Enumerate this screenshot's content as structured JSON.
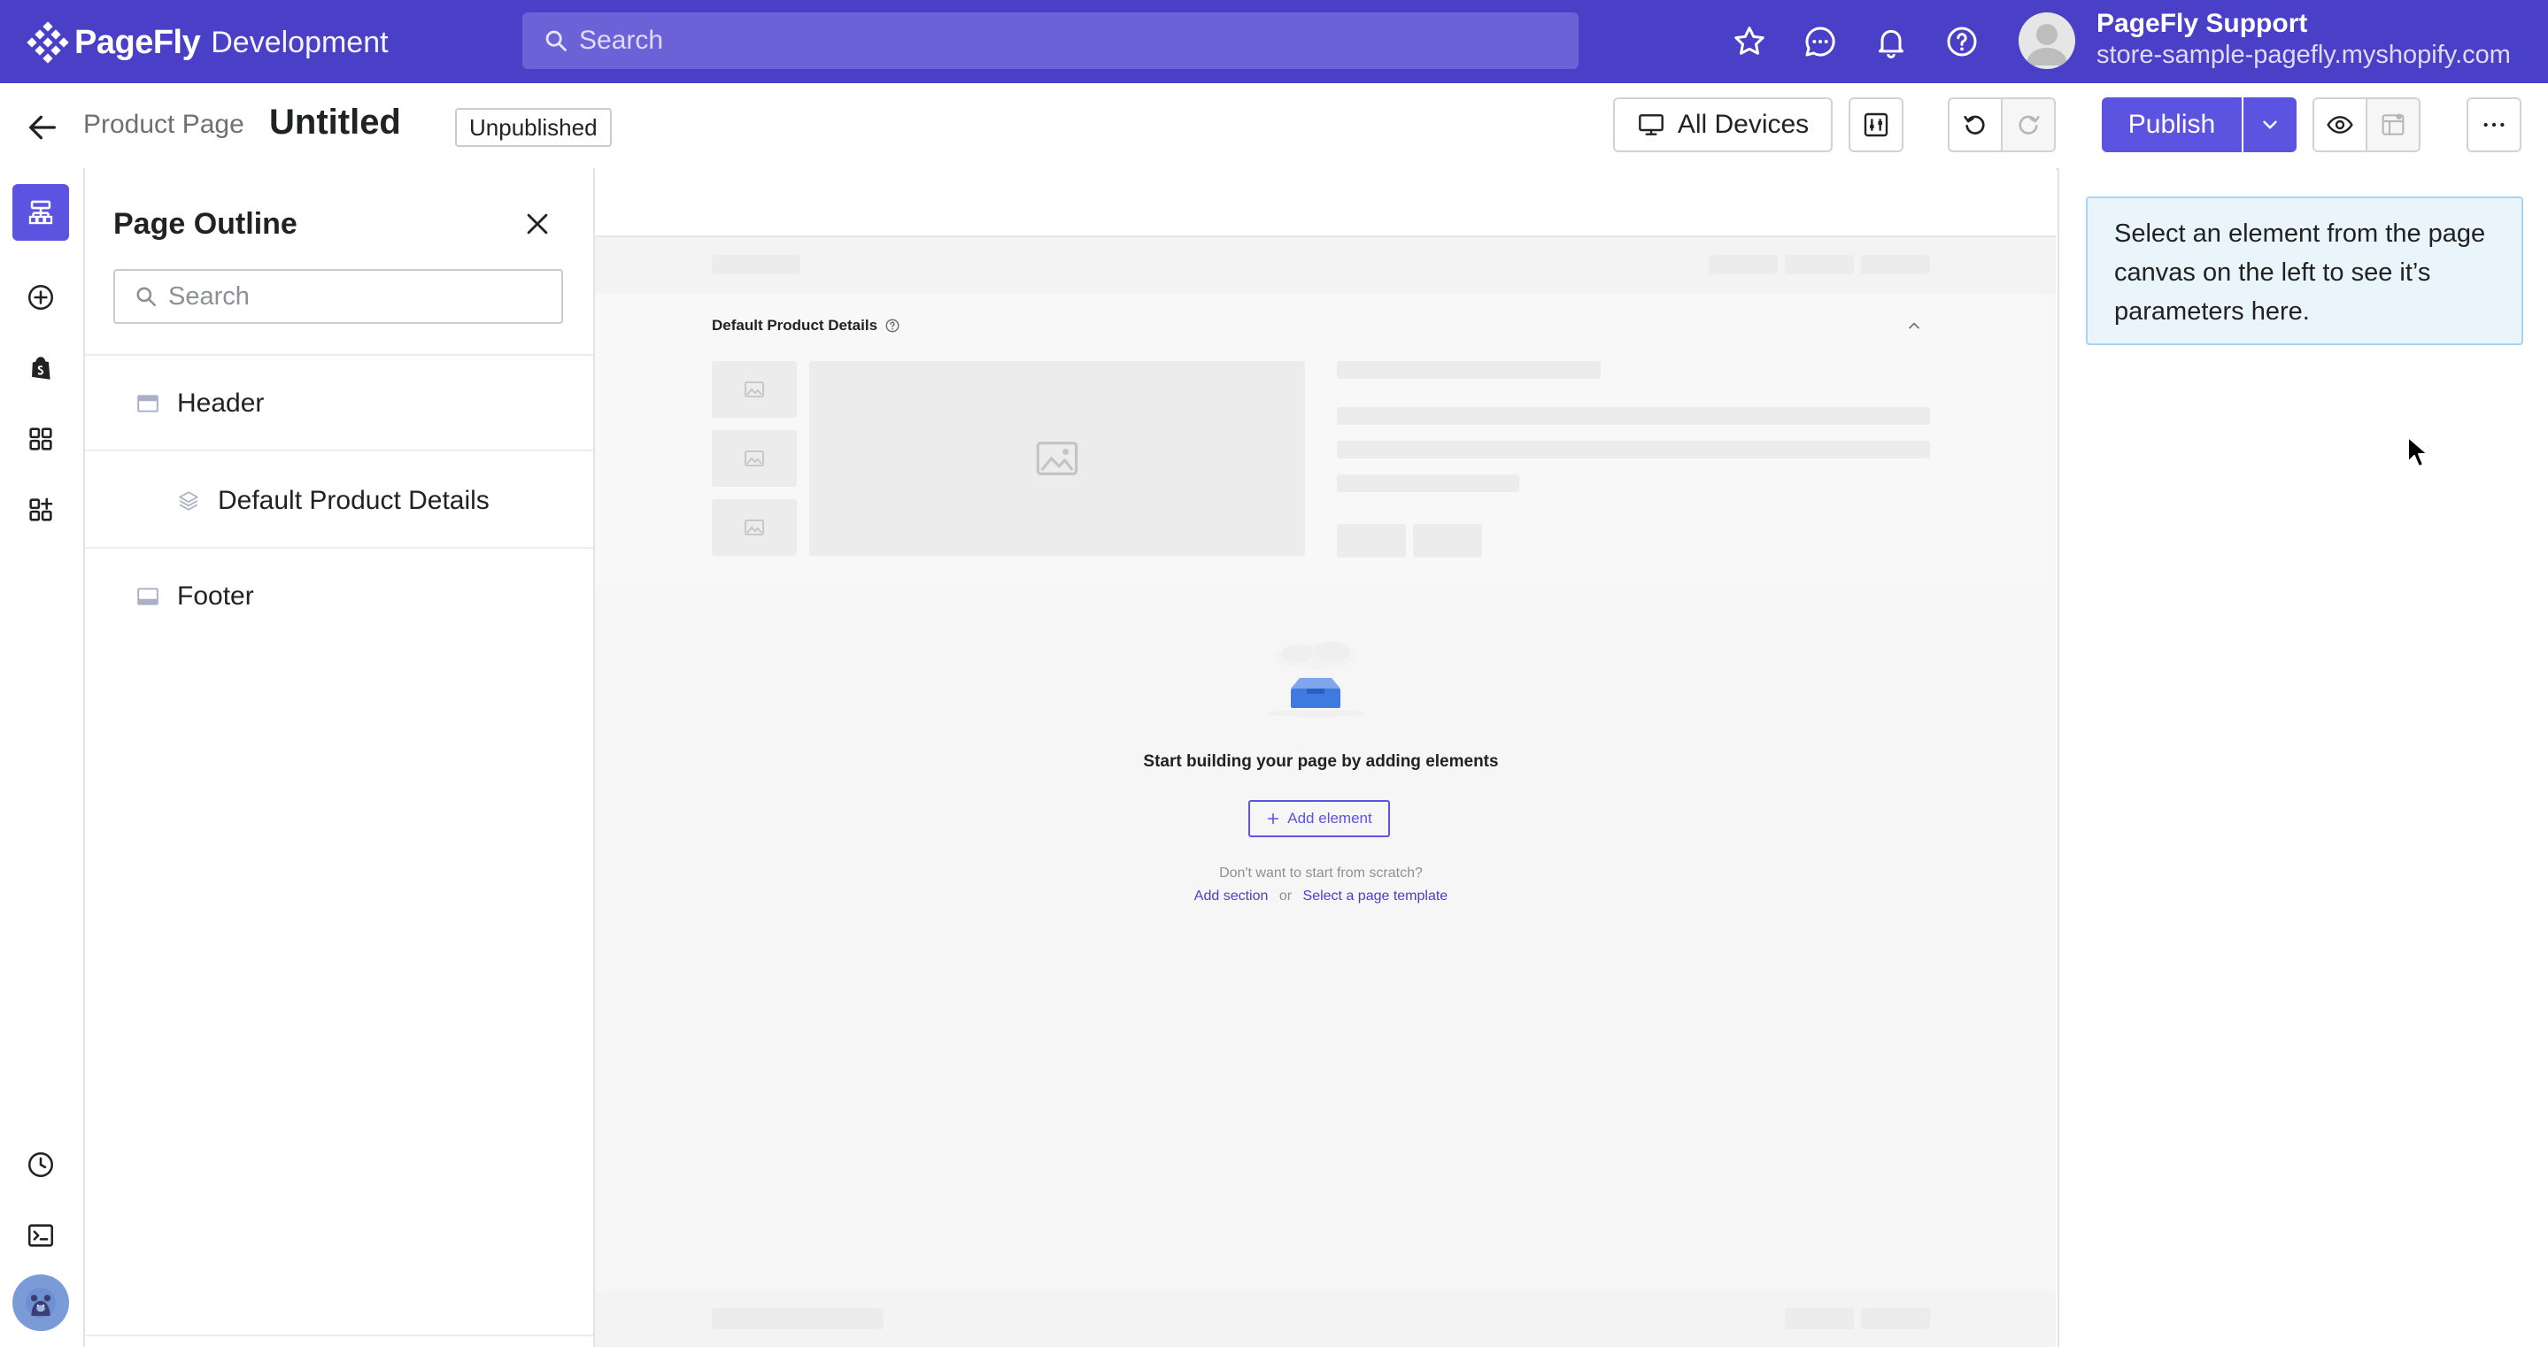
{
  "app": {
    "brand": "PageFly",
    "env": "Development",
    "search_placeholder": "Search",
    "user_name": "PageFly Support",
    "user_store": "store-sample-pagefly.myshopify.com",
    "accent": "#4a3fc7",
    "primary": "#5c53e0"
  },
  "toolbar": {
    "breadcrumb": "Product Page",
    "title": "Untitled",
    "status": "Unpublished",
    "devices_label": "All Devices",
    "publish_label": "Publish"
  },
  "outline": {
    "title": "Page Outline",
    "search_placeholder": "Search",
    "items": [
      {
        "label": "Header",
        "icon": "header-section-icon"
      },
      {
        "label": "Default Product Details",
        "icon": "layers-icon"
      },
      {
        "label": "Footer",
        "icon": "footer-section-icon"
      }
    ]
  },
  "canvas": {
    "section_label": "Default Product Details",
    "empty_message": "Start building your page by adding elements",
    "add_element_label": "Add element",
    "scratch_text": "Don't want to start from scratch?",
    "add_section_link": "Add section",
    "or_text": "or",
    "template_link": "Select a page template"
  },
  "right_panel": {
    "info": "Select an element from the page canvas on the left to see it’s parameters here."
  }
}
